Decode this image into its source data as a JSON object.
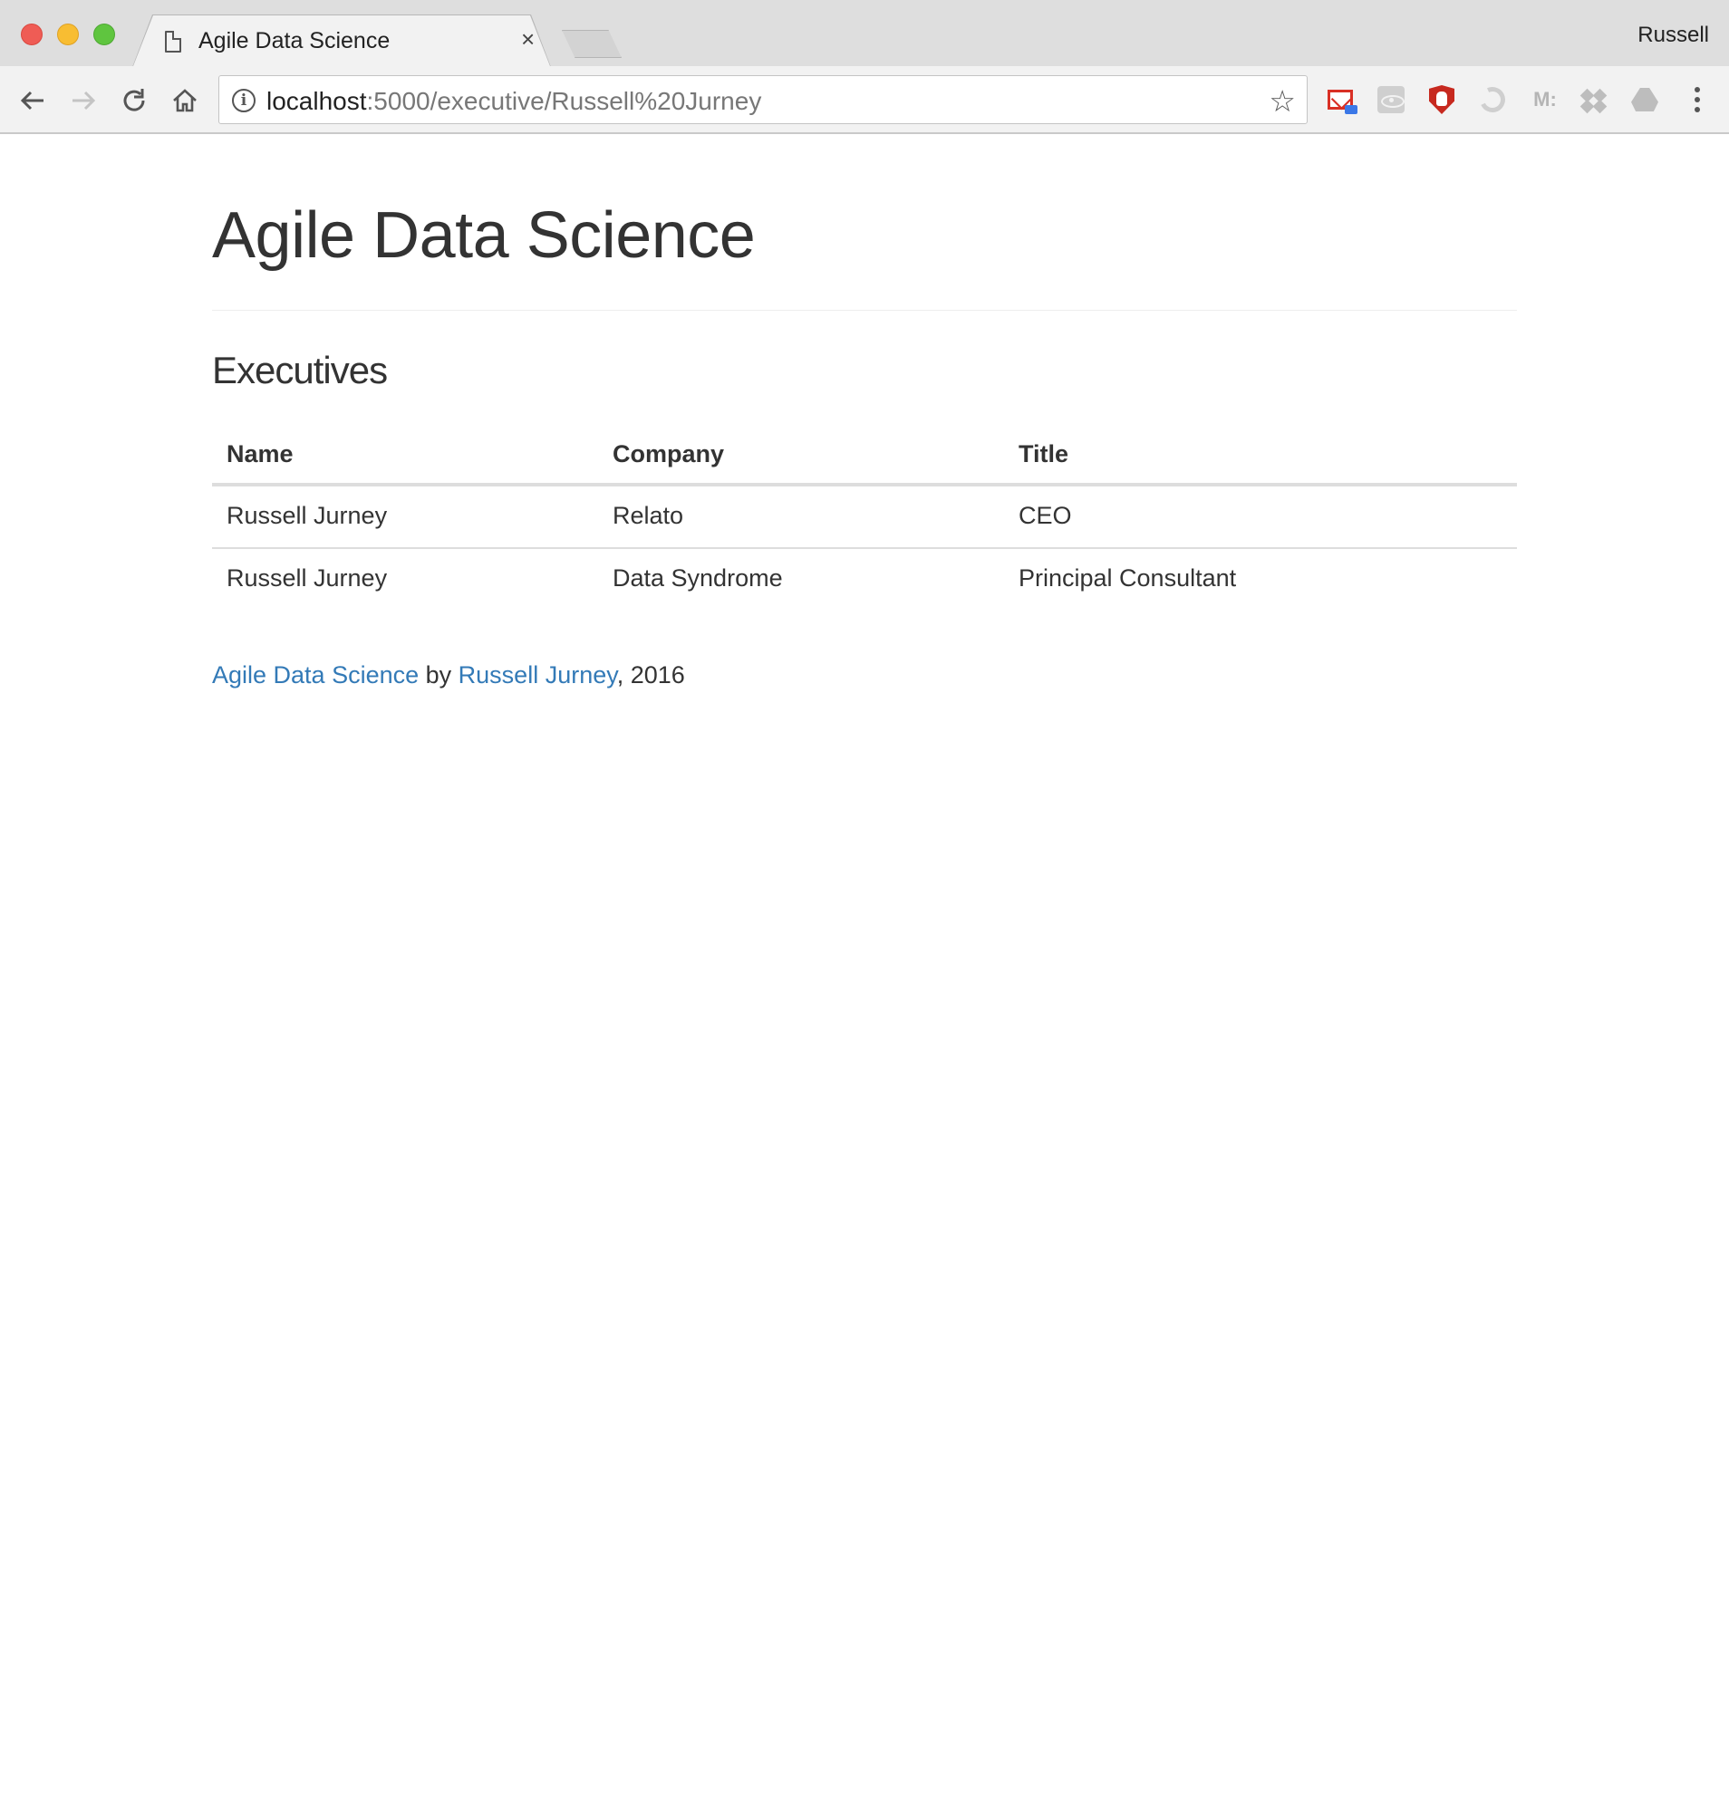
{
  "browser": {
    "tab_title": "Agile Data Science",
    "tab_close": "×",
    "profile_name": "Russell",
    "url_host": "localhost",
    "url_path": ":5000/executive/Russell%20Jurney",
    "extensions": [
      "gmail-icon",
      "react-devtools-icon",
      "ublock-icon",
      "swirl-icon",
      "markdown-icon",
      "dropbox-icon",
      "google-drive-icon"
    ],
    "ext_m_label": "M:"
  },
  "page": {
    "title": "Agile Data Science",
    "section_title": "Executives",
    "table": {
      "headers": [
        "Name",
        "Company",
        "Title"
      ],
      "rows": [
        [
          "Russell Jurney",
          "Relato",
          "CEO"
        ],
        [
          "Russell Jurney",
          "Data Syndrome",
          "Principal Consultant"
        ]
      ]
    },
    "footer": {
      "link1": "Agile Data Science",
      "by": " by ",
      "link2": "Russell Jurney",
      "suffix": ", 2016"
    }
  },
  "colors": {
    "link": "#337ab7",
    "text": "#333333",
    "chrome": "#dedede"
  }
}
